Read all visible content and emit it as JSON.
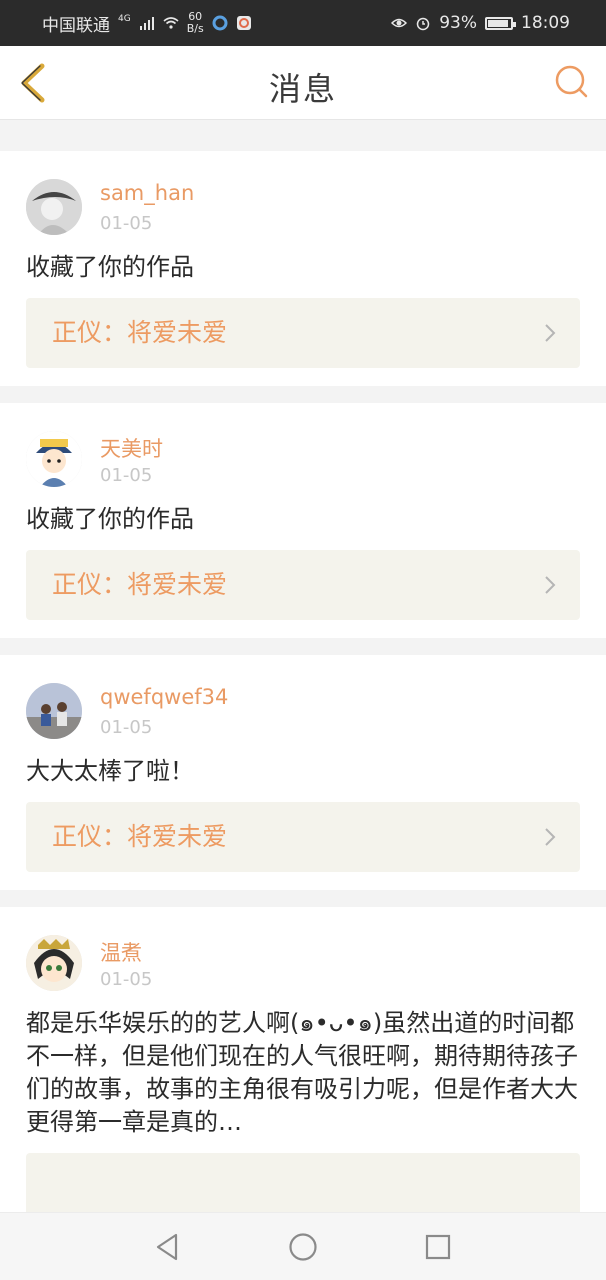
{
  "status_bar": {
    "carrier": "中国联通",
    "network": "4G",
    "speed_value": "60",
    "speed_unit": "B/s",
    "battery": "93%",
    "time": "18:09"
  },
  "header": {
    "title": "消息"
  },
  "messages": [
    {
      "username": "sam_han",
      "date": "01-05",
      "text": "收藏了你的作品",
      "work": "正仪：将爱未爱"
    },
    {
      "username": "天美时",
      "date": "01-05",
      "text": "收藏了你的作品",
      "work": "正仪：将爱未爱"
    },
    {
      "username": "qwefqwef34",
      "date": "01-05",
      "text": "大大太棒了啦！",
      "work": "正仪：将爱未爱"
    },
    {
      "username": "温煮",
      "date": "01-05",
      "text": "都是乐华娱乐的的艺人啊(๑•ᴗ•๑)虽然出道的时间都不一样，但是他们现在的人气很旺啊，期待期待孩子们的故事，故事的主角很有吸引力呢，但是作者大大更得第一章是真的…",
      "work": ""
    }
  ],
  "colors": {
    "accent": "#ed9b62",
    "username": "#e99a64",
    "back_icon": "#d9a93a"
  }
}
